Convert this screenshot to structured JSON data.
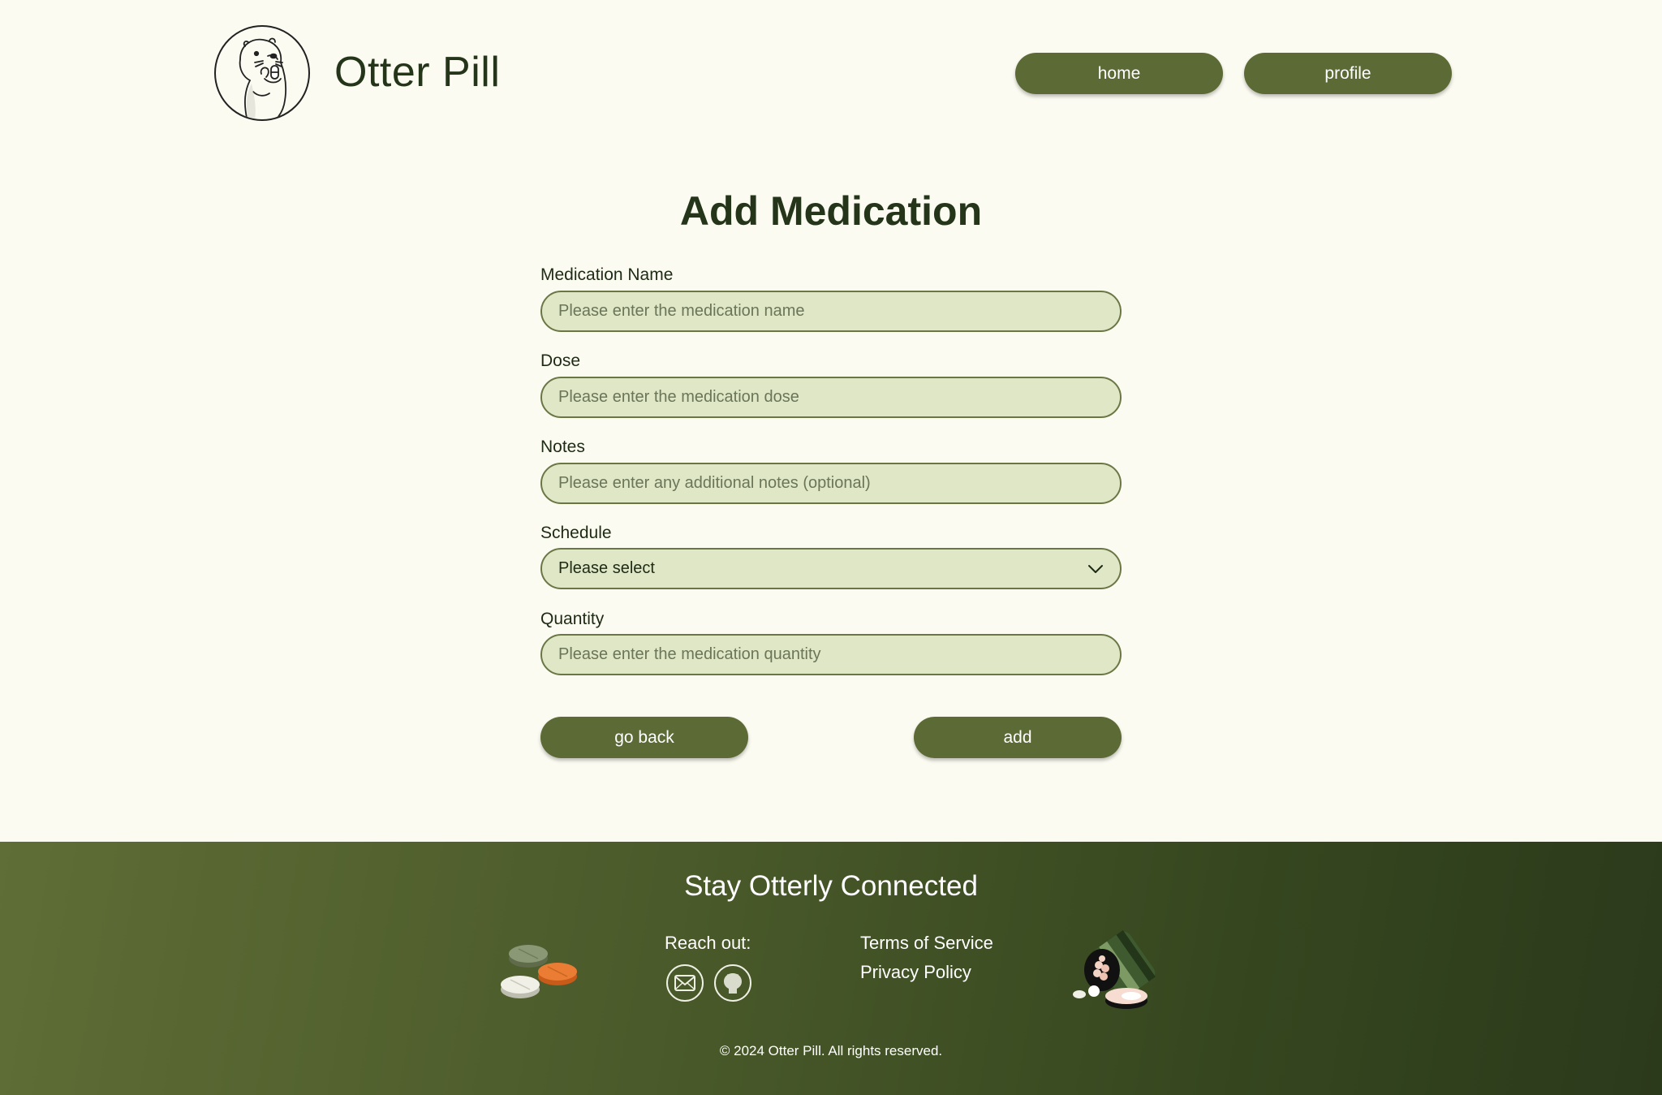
{
  "header": {
    "brand": "Otter Pill",
    "nav": {
      "home": "home",
      "profile": "profile"
    }
  },
  "form": {
    "title": "Add Medication",
    "fields": {
      "name": {
        "label": "Medication Name",
        "placeholder": "Please enter the medication name"
      },
      "dose": {
        "label": "Dose",
        "placeholder": "Please enter the medication dose"
      },
      "notes": {
        "label": "Notes",
        "placeholder": "Please enter any additional notes (optional)"
      },
      "schedule": {
        "label": "Schedule",
        "value": "Please select"
      },
      "quantity": {
        "label": "Quantity",
        "placeholder": "Please enter the medication quantity"
      }
    },
    "buttons": {
      "back": "go back",
      "add": "add"
    }
  },
  "footer": {
    "heading": "Stay Otterly Connected",
    "reach_out": "Reach out:",
    "icons": [
      "mail-icon",
      "github-icon"
    ],
    "links": {
      "terms": "Terms of Service",
      "privacy": "Privacy Policy"
    },
    "copyright": "© 2024 Otter Pill. All rights reserved."
  },
  "colors": {
    "background": "#fbfbf1",
    "accent": "#5c6b36",
    "input_fill": "#dfe7c7",
    "text_dark": "#25351a",
    "footer_dark": "#2b3a1b"
  }
}
